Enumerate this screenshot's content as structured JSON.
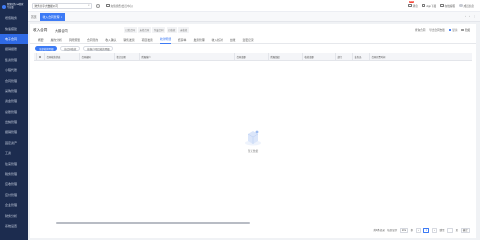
{
  "sidebar": {
    "logo_line1": "智慧财务OA管家",
    "logo_line2": "专业版",
    "items": [
      {
        "label": "增值税务",
        "active": false
      },
      {
        "label": "快速搭建",
        "active": false
      },
      {
        "label": "电子合同",
        "active": true
      },
      {
        "label": "报销报账",
        "active": false
      },
      {
        "label": "集资管理",
        "active": false
      },
      {
        "label": "小程代账",
        "active": false
      },
      {
        "label": "合同管理",
        "active": false
      },
      {
        "label": "采购管理",
        "active": false
      },
      {
        "label": "资金管理",
        "active": false
      },
      {
        "label": "总账管理",
        "active": false
      },
      {
        "label": "出纳管理",
        "active": false
      },
      {
        "label": "报销管理",
        "active": false
      },
      {
        "label": "固定资产",
        "active": false
      },
      {
        "label": "工资",
        "active": false
      },
      {
        "label": "往来管理",
        "active": false
      },
      {
        "label": "税务管理",
        "active": false
      },
      {
        "label": "应收管理",
        "active": false
      },
      {
        "label": "应付管理",
        "active": false
      },
      {
        "label": "企业管理",
        "active": false
      },
      {
        "label": "财务分析",
        "active": false
      },
      {
        "label": "系统设置",
        "active": false
      }
    ]
  },
  "topbar": {
    "entity": "财务共享大数据公司",
    "link": "充值续费(会员中心)",
    "badge": "99+",
    "items": [
      "消息",
      "App下载",
      "在线客服",
      "成员信息"
    ]
  },
  "tabs": [
    {
      "label": "首页",
      "active": false
    },
    {
      "label": "收入合同管理",
      "active": true
    }
  ],
  "main": {
    "title": "收入合同",
    "org": "大鹏合同",
    "chips": [
      "已签合同",
      "未签合同",
      "作废合同",
      "已收款",
      "未收款"
    ],
    "actions": {
      "query": "查询合同",
      "export": "导出合同台账",
      "check1": "显示",
      "check2": "隐藏"
    },
    "nav_tabs": [
      {
        "label": "概要",
        "active": false
      },
      {
        "label": "履约分析",
        "active": false
      },
      {
        "label": "风险预警",
        "active": false
      },
      {
        "label": "合同签约",
        "active": false
      },
      {
        "label": "收入确认",
        "active": false
      },
      {
        "label": "销售发票",
        "active": false
      },
      {
        "label": "项目发票",
        "active": false
      },
      {
        "label": "收款明细",
        "active": true
      },
      {
        "label": "结算单",
        "active": false
      },
      {
        "label": "发票管理",
        "active": false
      },
      {
        "label": "收入核对",
        "active": false
      },
      {
        "label": "台账",
        "active": false
      },
      {
        "label": "变更记录",
        "active": false
      }
    ],
    "sub_buttons": [
      {
        "label": "全部收款明细",
        "active": true
      },
      {
        "label": "按合同收款",
        "active": false
      },
      {
        "label": "按客户/项目收款明细",
        "active": false
      }
    ],
    "columns": [
      "全选",
      "合同收款状态",
      "合同编码",
      "签订日期",
      "所属客户",
      "合同金额",
      "所属组织",
      "收款金额",
      "部门",
      "业务员",
      "合同开票时间"
    ],
    "empty_text": "暂无数据"
  },
  "pager": {
    "total": "共0条记录",
    "per_page": "每页显示",
    "page_size": "20",
    "unit": "条",
    "prev": "‹",
    "current": "1",
    "next": "›",
    "goto": "跳至",
    "page": "页",
    "confirm": "确定"
  }
}
